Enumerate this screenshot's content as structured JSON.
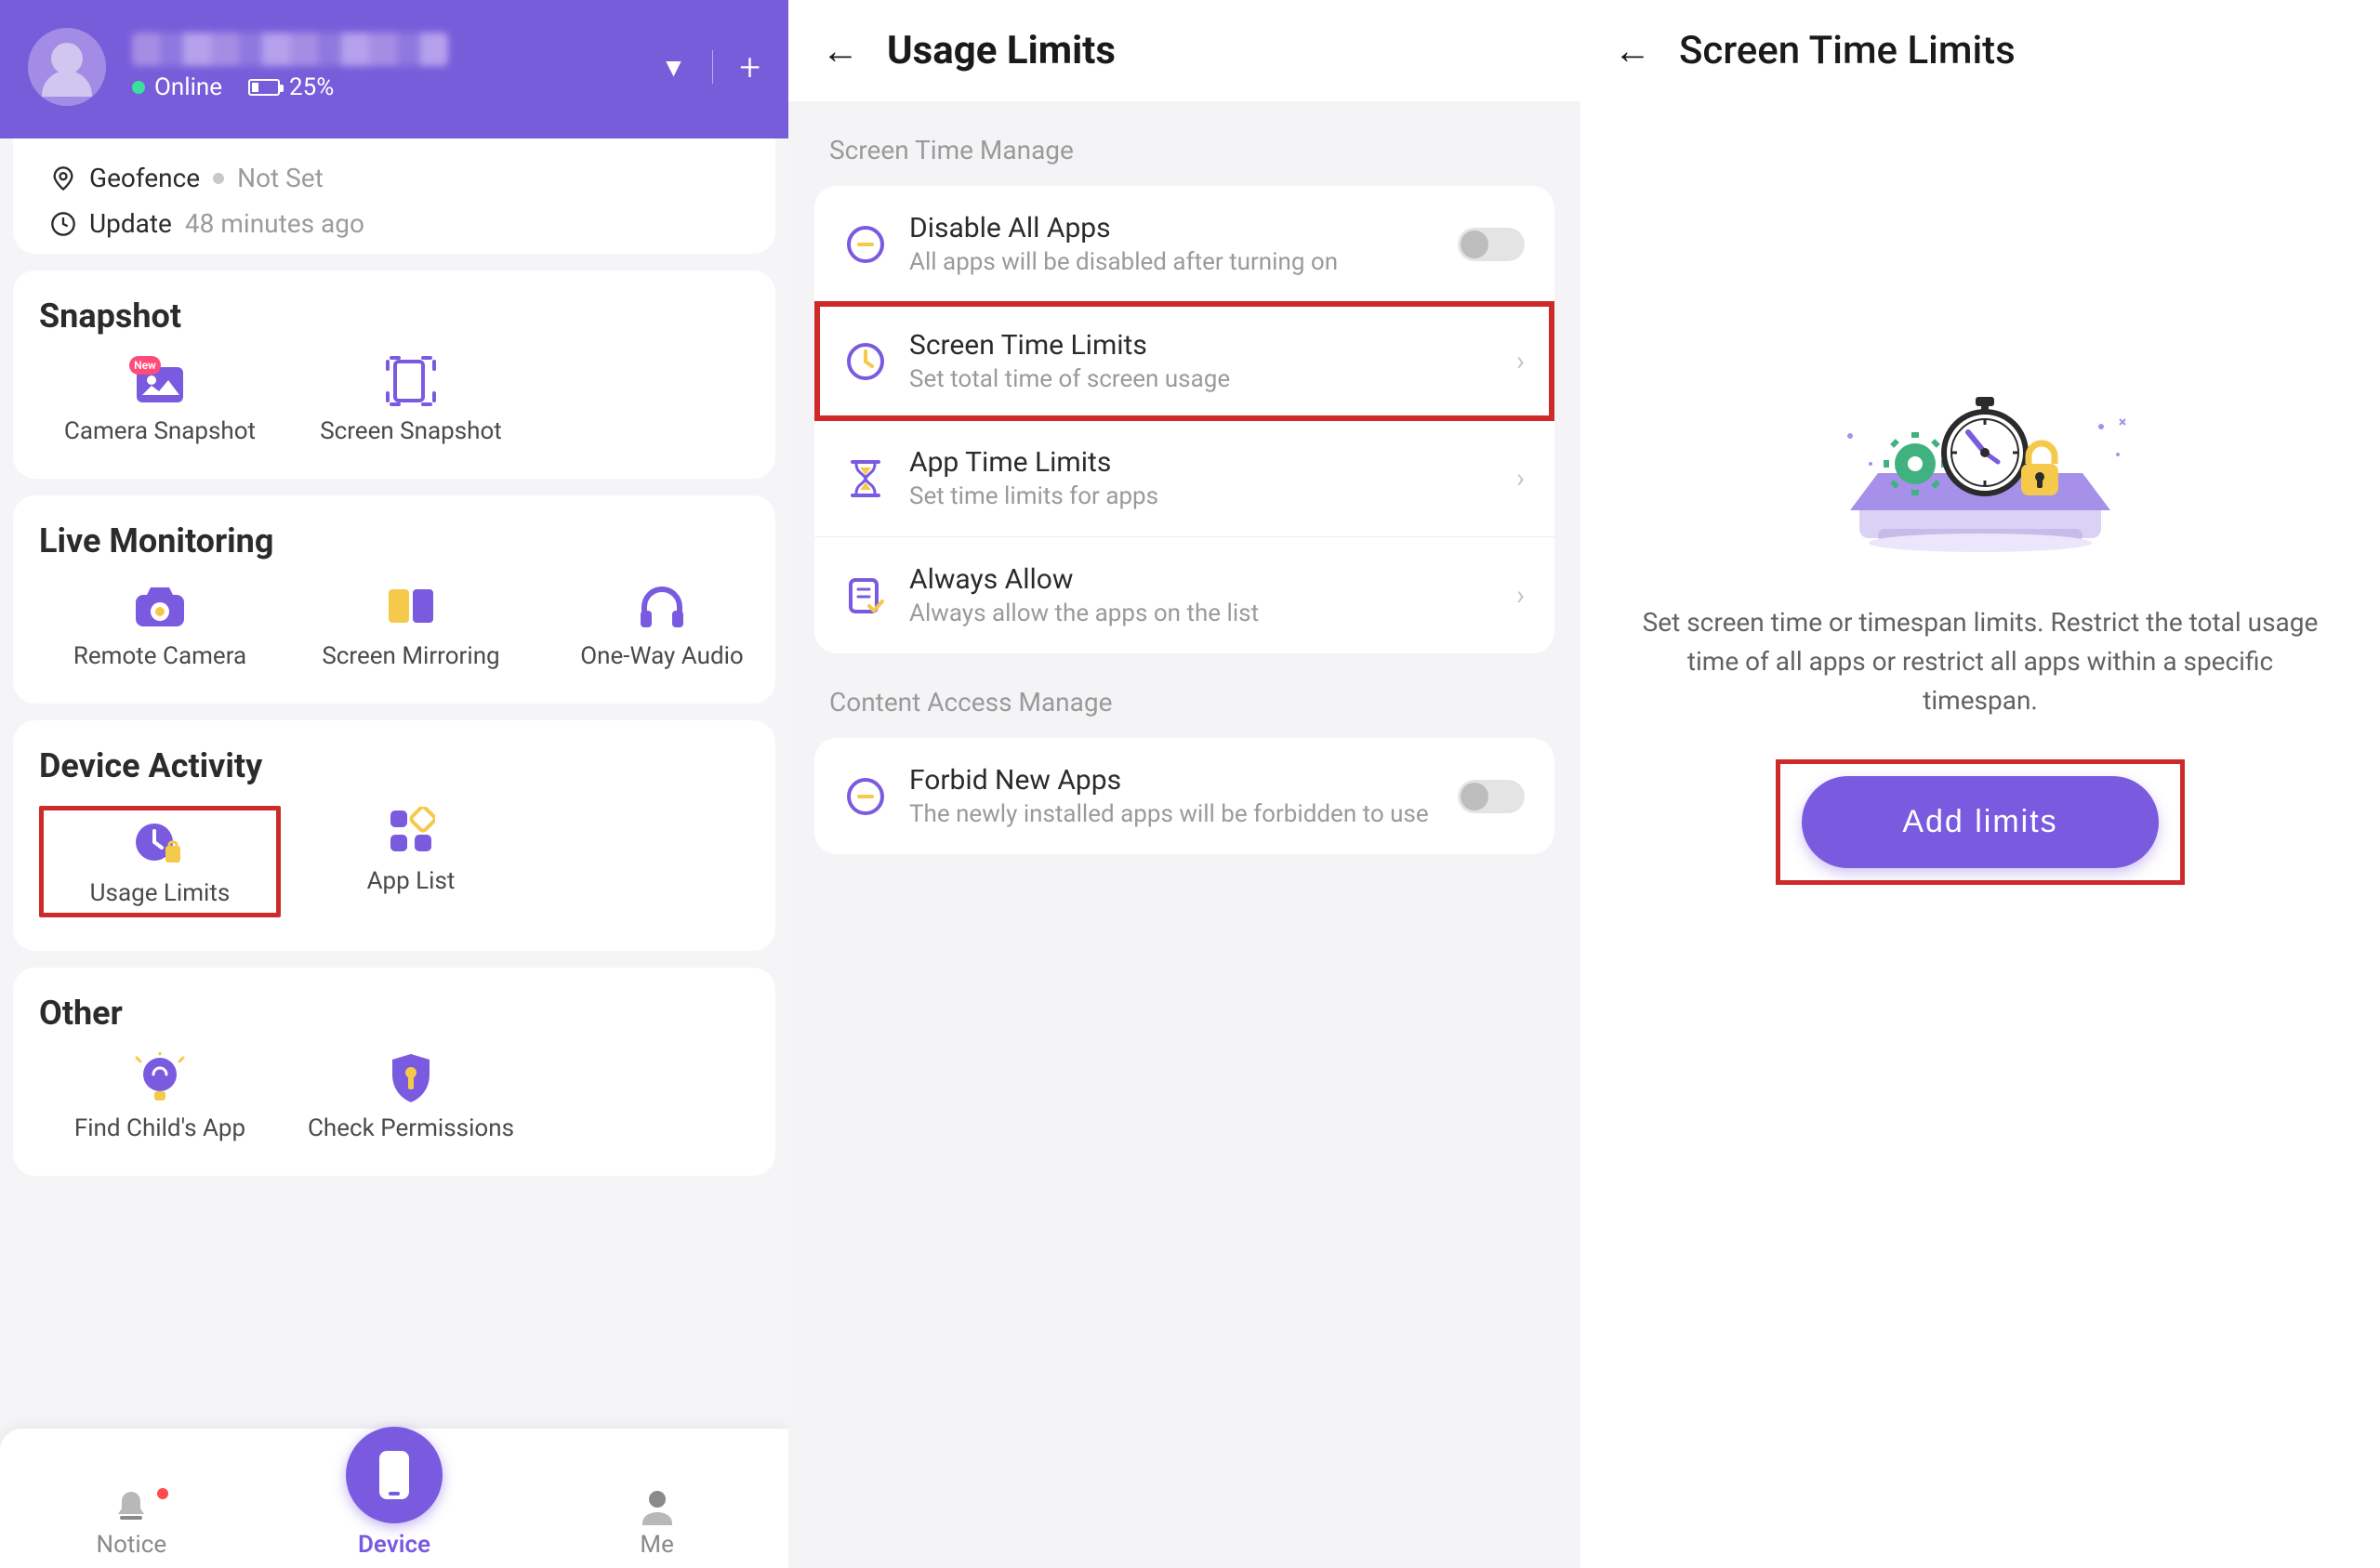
{
  "colors": {
    "accent": "#7a5be0",
    "highlight": "#cf2a2a"
  },
  "panel1": {
    "profile": {
      "online_label": "Online",
      "battery_text": "25%"
    },
    "geofence": {
      "label": "Geofence",
      "value": "Not Set"
    },
    "update": {
      "label": "Update",
      "value": "48 minutes ago"
    },
    "snapshot": {
      "title": "Snapshot",
      "items": [
        {
          "name": "camera-snapshot",
          "label": "Camera Snapshot",
          "icon": "camera-snapshot-icon",
          "badge": "New"
        },
        {
          "name": "screen-snapshot",
          "label": "Screen Snapshot",
          "icon": "screen-snapshot-icon"
        }
      ]
    },
    "live": {
      "title": "Live Monitoring",
      "items": [
        {
          "name": "remote-camera",
          "label": "Remote Camera",
          "icon": "remote-camera-icon"
        },
        {
          "name": "screen-mirroring",
          "label": "Screen Mirroring",
          "icon": "screen-mirroring-icon"
        },
        {
          "name": "one-way-audio",
          "label": "One-Way Audio",
          "icon": "headphones-icon"
        }
      ]
    },
    "device_activity": {
      "title": "Device Activity",
      "items": [
        {
          "name": "usage-limits",
          "label": "Usage Limits",
          "icon": "usage-limits-icon",
          "highlighted": true
        },
        {
          "name": "app-list",
          "label": "App List",
          "icon": "app-list-icon"
        }
      ]
    },
    "other": {
      "title": "Other",
      "items": [
        {
          "name": "find-childs-app",
          "label": "Find Child's App",
          "icon": "lightbulb-icon"
        },
        {
          "name": "check-permissions",
          "label": "Check Permissions",
          "icon": "shield-key-icon"
        }
      ]
    },
    "nav": {
      "notice": "Notice",
      "device": "Device",
      "me": "Me"
    }
  },
  "panel2": {
    "title": "Usage Limits",
    "section1": "Screen Time Manage",
    "rows1": [
      {
        "name": "disable-all-apps",
        "title": "Disable All Apps",
        "sub": "All apps will be disabled after turning on",
        "trailer": "toggle"
      },
      {
        "name": "screen-time-limits",
        "title": "Screen Time Limits",
        "sub": "Set total time of screen usage",
        "trailer": "chevron",
        "highlighted": true
      },
      {
        "name": "app-time-limits",
        "title": "App Time Limits",
        "sub": "Set time limits for apps",
        "trailer": "chevron"
      },
      {
        "name": "always-allow",
        "title": "Always Allow",
        "sub": "Always allow the apps on the list",
        "trailer": "chevron"
      }
    ],
    "section2": "Content Access Manage",
    "rows2": [
      {
        "name": "forbid-new-apps",
        "title": "Forbid New Apps",
        "sub": "The newly installed apps will be forbidden to use",
        "trailer": "toggle"
      }
    ]
  },
  "panel3": {
    "title": "Screen Time Limits",
    "description": "Set screen time or timespan limits. Restrict the total usage time of all apps or restrict all apps within a specific timespan.",
    "button": "Add limits"
  }
}
